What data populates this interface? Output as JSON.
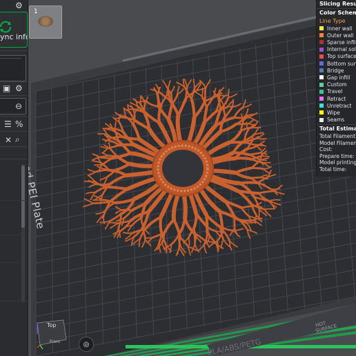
{
  "sidebar": {
    "sync_label": "ync info",
    "filter_icon": "☰",
    "percent_icon": "%",
    "close_icon": "✕"
  },
  "thumbnail": {
    "number": "1"
  },
  "legend": {
    "title": "Slicing Result",
    "scheme_label": "Color Scheme",
    "line_type_label": "Line Type",
    "items": [
      {
        "label": "Inner wall",
        "color": "#ffe64d"
      },
      {
        "label": "Outer wall",
        "color": "#ff7d38"
      },
      {
        "label": "Sparse infill",
        "color": "#b03029"
      },
      {
        "label": "Internal solid in",
        "color": "#9654cc"
      },
      {
        "label": "Top surface",
        "color": "#f04b4b"
      },
      {
        "label": "Bottom surfac",
        "color": "#666ad8"
      },
      {
        "label": "Bridge",
        "color": "#4d80ba"
      },
      {
        "label": "Gap infill",
        "color": "#ffffff"
      },
      {
        "label": "Custom",
        "color": "#5ed194"
      },
      {
        "label": "Travel",
        "color": "#38c2a0"
      },
      {
        "label": "Retract",
        "color": "#e86ff0"
      },
      {
        "label": "Unretract",
        "color": "#38e0e0"
      },
      {
        "label": "Wipe",
        "color": "#ffff00"
      },
      {
        "label": "Seams",
        "color": "#e6e6e6"
      }
    ],
    "estimation_title": "Total Estimation",
    "estimations": [
      "Total Filament:",
      "Model Filament:",
      "Cost:",
      "Prepare time:",
      "Model printing ti",
      "Total time:"
    ]
  },
  "plate": {
    "label": "Textured PEI Plate",
    "hot_label": "HOT",
    "surface_label": "SURFACE",
    "material_label": "PLA/ABS/PETG"
  },
  "viewcube": {
    "top_label": "Top",
    "front_label": "Front"
  },
  "colors": {
    "accent": "#00ae42",
    "model": "#c8602f",
    "plate": "#2b2c2f",
    "grid": "#4a4c52"
  }
}
